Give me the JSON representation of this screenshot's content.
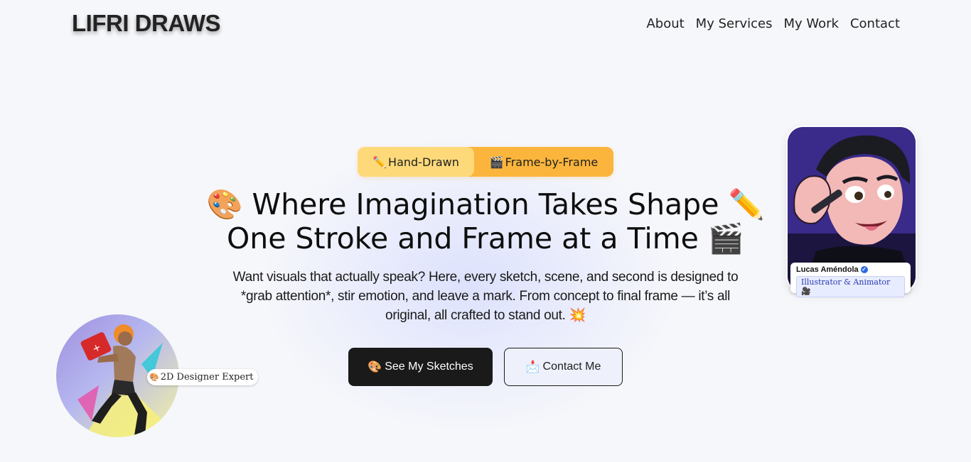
{
  "header": {
    "logo": "LIFRI DRAWS",
    "nav": [
      "About",
      "My Services",
      "My Work",
      "Contact"
    ]
  },
  "hero": {
    "pills": [
      {
        "icon": "✏️",
        "label": "Hand-Drawn"
      },
      {
        "icon": "🎬",
        "label": "Frame-by-Frame"
      }
    ],
    "headline_line1": "🎨 Where Imagination Takes Shape ✏️",
    "headline_line2": "One Stroke and Frame at a Time 🎬",
    "subtitle": "Want visuals that actually speak? Here, every sketch, scene, and second is designed to *grab attention*, stir emotion, and leave a mark. From concept to final frame — it’s all original, all crafted to stand out. 💥",
    "primary_button": {
      "icon": "🎨",
      "label": "See My Sketches"
    },
    "secondary_button": {
      "icon": "📩",
      "label": "Contact Me"
    }
  },
  "profile_card": {
    "name": "Lucas Améndola",
    "verified_icon": "verified-check-icon",
    "role": "Illustrator & Animator 🎥"
  },
  "avatar_badge": {
    "icon": "🎨",
    "label": "2D Designer Expert"
  },
  "colors": {
    "background": "#f6f7fb",
    "pill_bg": "#fbb53c",
    "pill_active": "#fdd97a",
    "primary_button": "#1a1a1a",
    "portrait_bg": "#3b2a8c"
  }
}
